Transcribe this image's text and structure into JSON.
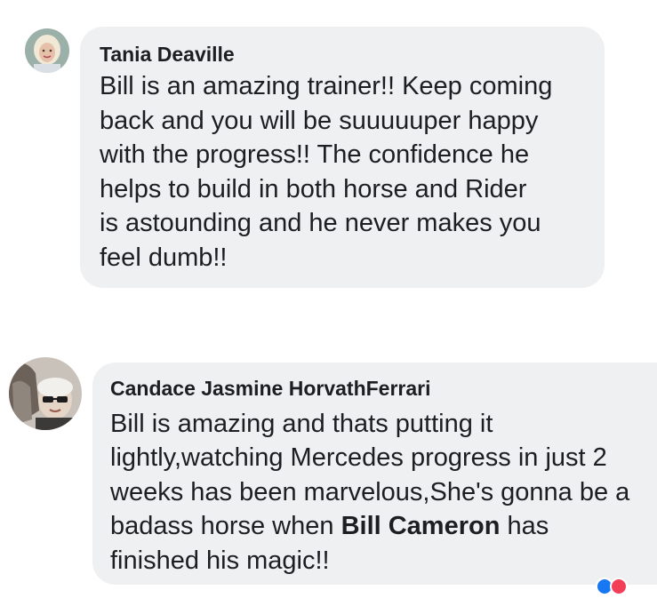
{
  "comments": [
    {
      "author": "Tania Deaville",
      "avatar_icon": "profile-photo-blonde-woman",
      "text": "Bill is an amazing trainer!! Keep coming\nback and you will be suuuuuper happy\nwith the progress!! The confidence he\nhelps to build in both horse and Rider\nis astounding and he never makes you\nfeel dumb!!"
    },
    {
      "author": "Candace Jasmine HorvathFerrari",
      "avatar_icon": "profile-photo-woman-with-sunglasses-and-horse",
      "text_before": "Bill is amazing and thats putting it\nlightly,watching Mercedes progress in just 2\nweeks has been marvelous,She's gonna be a\nbadass horse when ",
      "mention": "Bill Cameron",
      "text_after": " has\nfinished his magic!!"
    }
  ],
  "colors": {
    "bubble_background": "#eef0f2",
    "text": "#1c1e21",
    "page_background": "#ffffff"
  },
  "icons": [
    "reaction-like-icon",
    "reaction-love-icon"
  ]
}
